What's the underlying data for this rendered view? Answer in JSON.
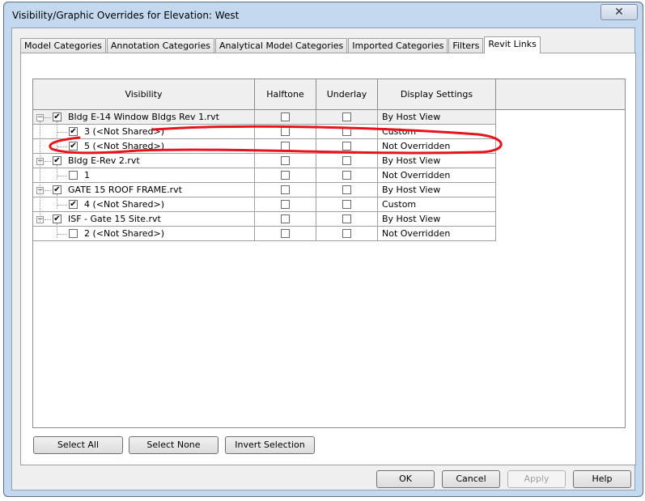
{
  "window": {
    "title": "Visibility/Graphic Overrides for Elevation: West",
    "close_label": "✕"
  },
  "tabs": [
    {
      "label": "Model Categories"
    },
    {
      "label": "Annotation Categories"
    },
    {
      "label": "Analytical Model Categories"
    },
    {
      "label": "Imported Categories"
    },
    {
      "label": "Filters"
    },
    {
      "label": "Revit Links",
      "active": true
    }
  ],
  "grid": {
    "columns": [
      "Visibility",
      "Halftone",
      "Underlay",
      "Display Settings"
    ],
    "rows": [
      {
        "level": 0,
        "label": "Bldg E-14 Window Bldgs Rev 1.rvt",
        "visible": true,
        "halftone": false,
        "underlay": false,
        "display": "By Host View"
      },
      {
        "level": 1,
        "label": "3 (<Not Shared>)",
        "visible": true,
        "halftone": false,
        "underlay": false,
        "display": "Custom"
      },
      {
        "level": 1,
        "label": "5 (<Not Shared>)",
        "visible": true,
        "halftone": false,
        "underlay": false,
        "display": "Not Overridden"
      },
      {
        "level": 0,
        "label": "Bldg E-Rev 2.rvt",
        "visible": true,
        "halftone": false,
        "underlay": false,
        "display": "By Host View"
      },
      {
        "level": 1,
        "label": "1",
        "visible": false,
        "halftone": false,
        "underlay": false,
        "display": "Not Overridden"
      },
      {
        "level": 0,
        "label": "GATE 15 ROOF FRAME.rvt",
        "visible": true,
        "halftone": false,
        "underlay": false,
        "display": "By Host View"
      },
      {
        "level": 1,
        "label": "4 (<Not Shared>)",
        "visible": true,
        "halftone": false,
        "underlay": false,
        "display": "Custom"
      },
      {
        "level": 0,
        "label": "ISF - Gate 15 Site.rvt",
        "visible": true,
        "halftone": false,
        "underlay": false,
        "display": "By Host View"
      },
      {
        "level": 1,
        "label": "2 (<Not Shared>)",
        "visible": false,
        "halftone": false,
        "underlay": false,
        "display": "Not Overridden"
      }
    ]
  },
  "selection_buttons": {
    "select_all": "Select All",
    "select_none": "Select None",
    "invert": "Invert Selection"
  },
  "dialog_buttons": {
    "ok": "OK",
    "cancel": "Cancel",
    "apply": "Apply",
    "help": "Help"
  },
  "annotation_color": "#e8141c"
}
